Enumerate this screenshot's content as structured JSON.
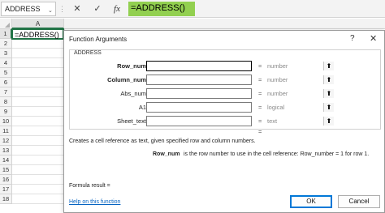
{
  "formula_bar": {
    "name_box": "ADDRESS",
    "name_box_caret": "⌄",
    "cancel_glyph": "✕",
    "enter_glyph": "✓",
    "fx_label": "fx",
    "formula": "=ADDRESS()"
  },
  "grid": {
    "column_header": "A",
    "row_headers": [
      "1",
      "2",
      "3",
      "4",
      "5",
      "6",
      "7",
      "8",
      "9",
      "10",
      "11",
      "12",
      "13",
      "14",
      "15",
      "16",
      "17",
      "18"
    ],
    "active_cell_value": "=ADDRESS()"
  },
  "dialog": {
    "title": "Function Arguments",
    "help_glyph": "?",
    "close_glyph": "✕",
    "function_name": "ADDRESS",
    "arguments": [
      {
        "label": "Row_num",
        "equals": "=",
        "type": "number"
      },
      {
        "label": "Column_num",
        "equals": "=",
        "type": "number"
      },
      {
        "label": "Abs_num",
        "equals": "=",
        "type": "number"
      },
      {
        "label": "A1",
        "equals": "=",
        "type": "logical"
      },
      {
        "label": "Sheet_text",
        "equals": "=",
        "type": "text"
      }
    ],
    "collapse_glyph": "⬆",
    "result_equals": "=",
    "description": "Creates a cell reference as text, given specified row and column numbers.",
    "arg_detail_name": "Row_num",
    "arg_detail_text": "is the row number to use in the cell reference: Row_number = 1 for row 1.",
    "formula_result": "Formula result =",
    "help_link": "Help on this function",
    "ok_label": "OK",
    "cancel_label": "Cancel"
  },
  "colors": {
    "formula_highlight": "#92d050",
    "selection_green": "#217346",
    "ok_focus": "#0078d7",
    "link": "#0563c1"
  }
}
